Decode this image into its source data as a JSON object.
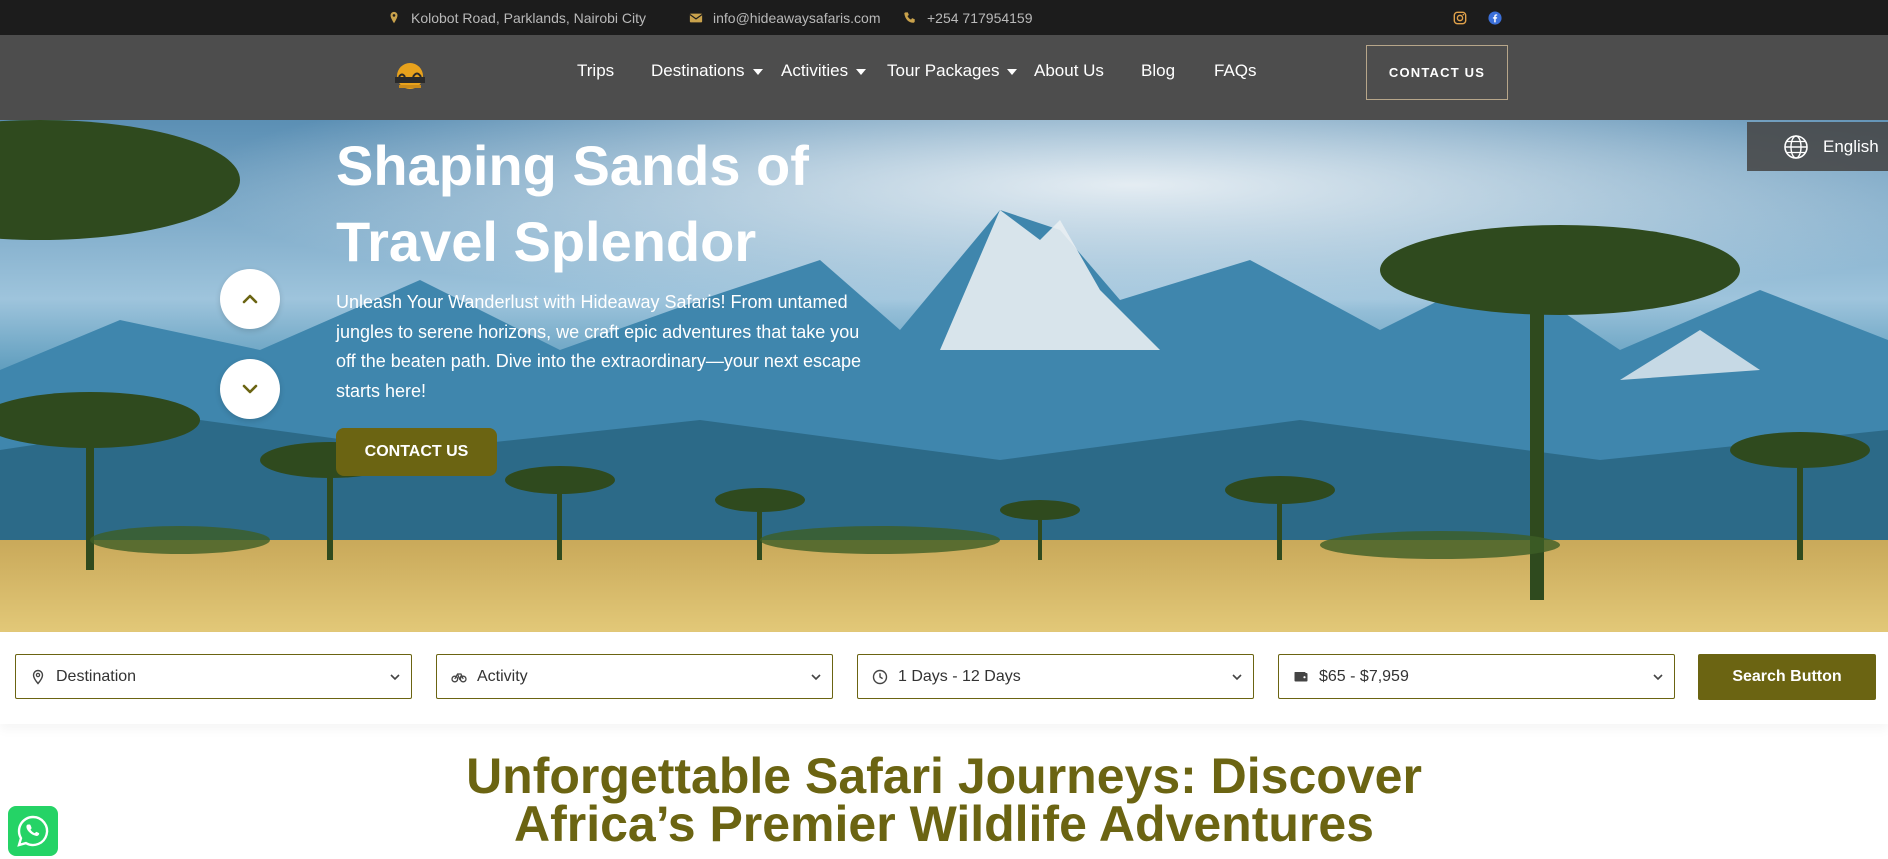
{
  "topbar": {
    "address": "Kolobot Road, Parklands, Nairobi City",
    "email": "info@hideawaysafaris.com",
    "phone": "+254 717954159",
    "social": [
      "instagram-icon",
      "facebook-icon"
    ]
  },
  "nav": {
    "items": [
      {
        "label": "Trips",
        "has_dropdown": false
      },
      {
        "label": "Destinations",
        "has_dropdown": true
      },
      {
        "label": "Activities",
        "has_dropdown": true
      },
      {
        "label": "Tour Packages",
        "has_dropdown": true
      },
      {
        "label": "About Us",
        "has_dropdown": false
      },
      {
        "label": "Blog",
        "has_dropdown": false
      },
      {
        "label": "FAQs",
        "has_dropdown": false
      }
    ],
    "contact_label": "CONTACT US"
  },
  "language": {
    "label": "English"
  },
  "hero": {
    "title_line1": "Shaping Sands of",
    "title_line2": "Travel Splendor",
    "text": "Unleash Your Wanderlust with Hideaway Safaris! From untamed jungles to serene horizons, we craft epic adventures that take you off the beaten path. Dive into the extraordinary—your next escape starts here!",
    "button": "CONTACT US"
  },
  "search": {
    "destination": "Destination",
    "activity": "Activity",
    "duration": "1 Days - 12 Days",
    "price": "$65 - $7,959",
    "button": "Search Button"
  },
  "section": {
    "title_line1": "Unforgettable Safari Journeys: Discover",
    "title_line2": "Africa’s Premier Wildlife Adventures"
  },
  "colors": {
    "topbar_bg": "#1c1c1c",
    "header_bg": "#4d4d4d",
    "accent": "#6b6412",
    "whatsapp": "#25d366"
  }
}
